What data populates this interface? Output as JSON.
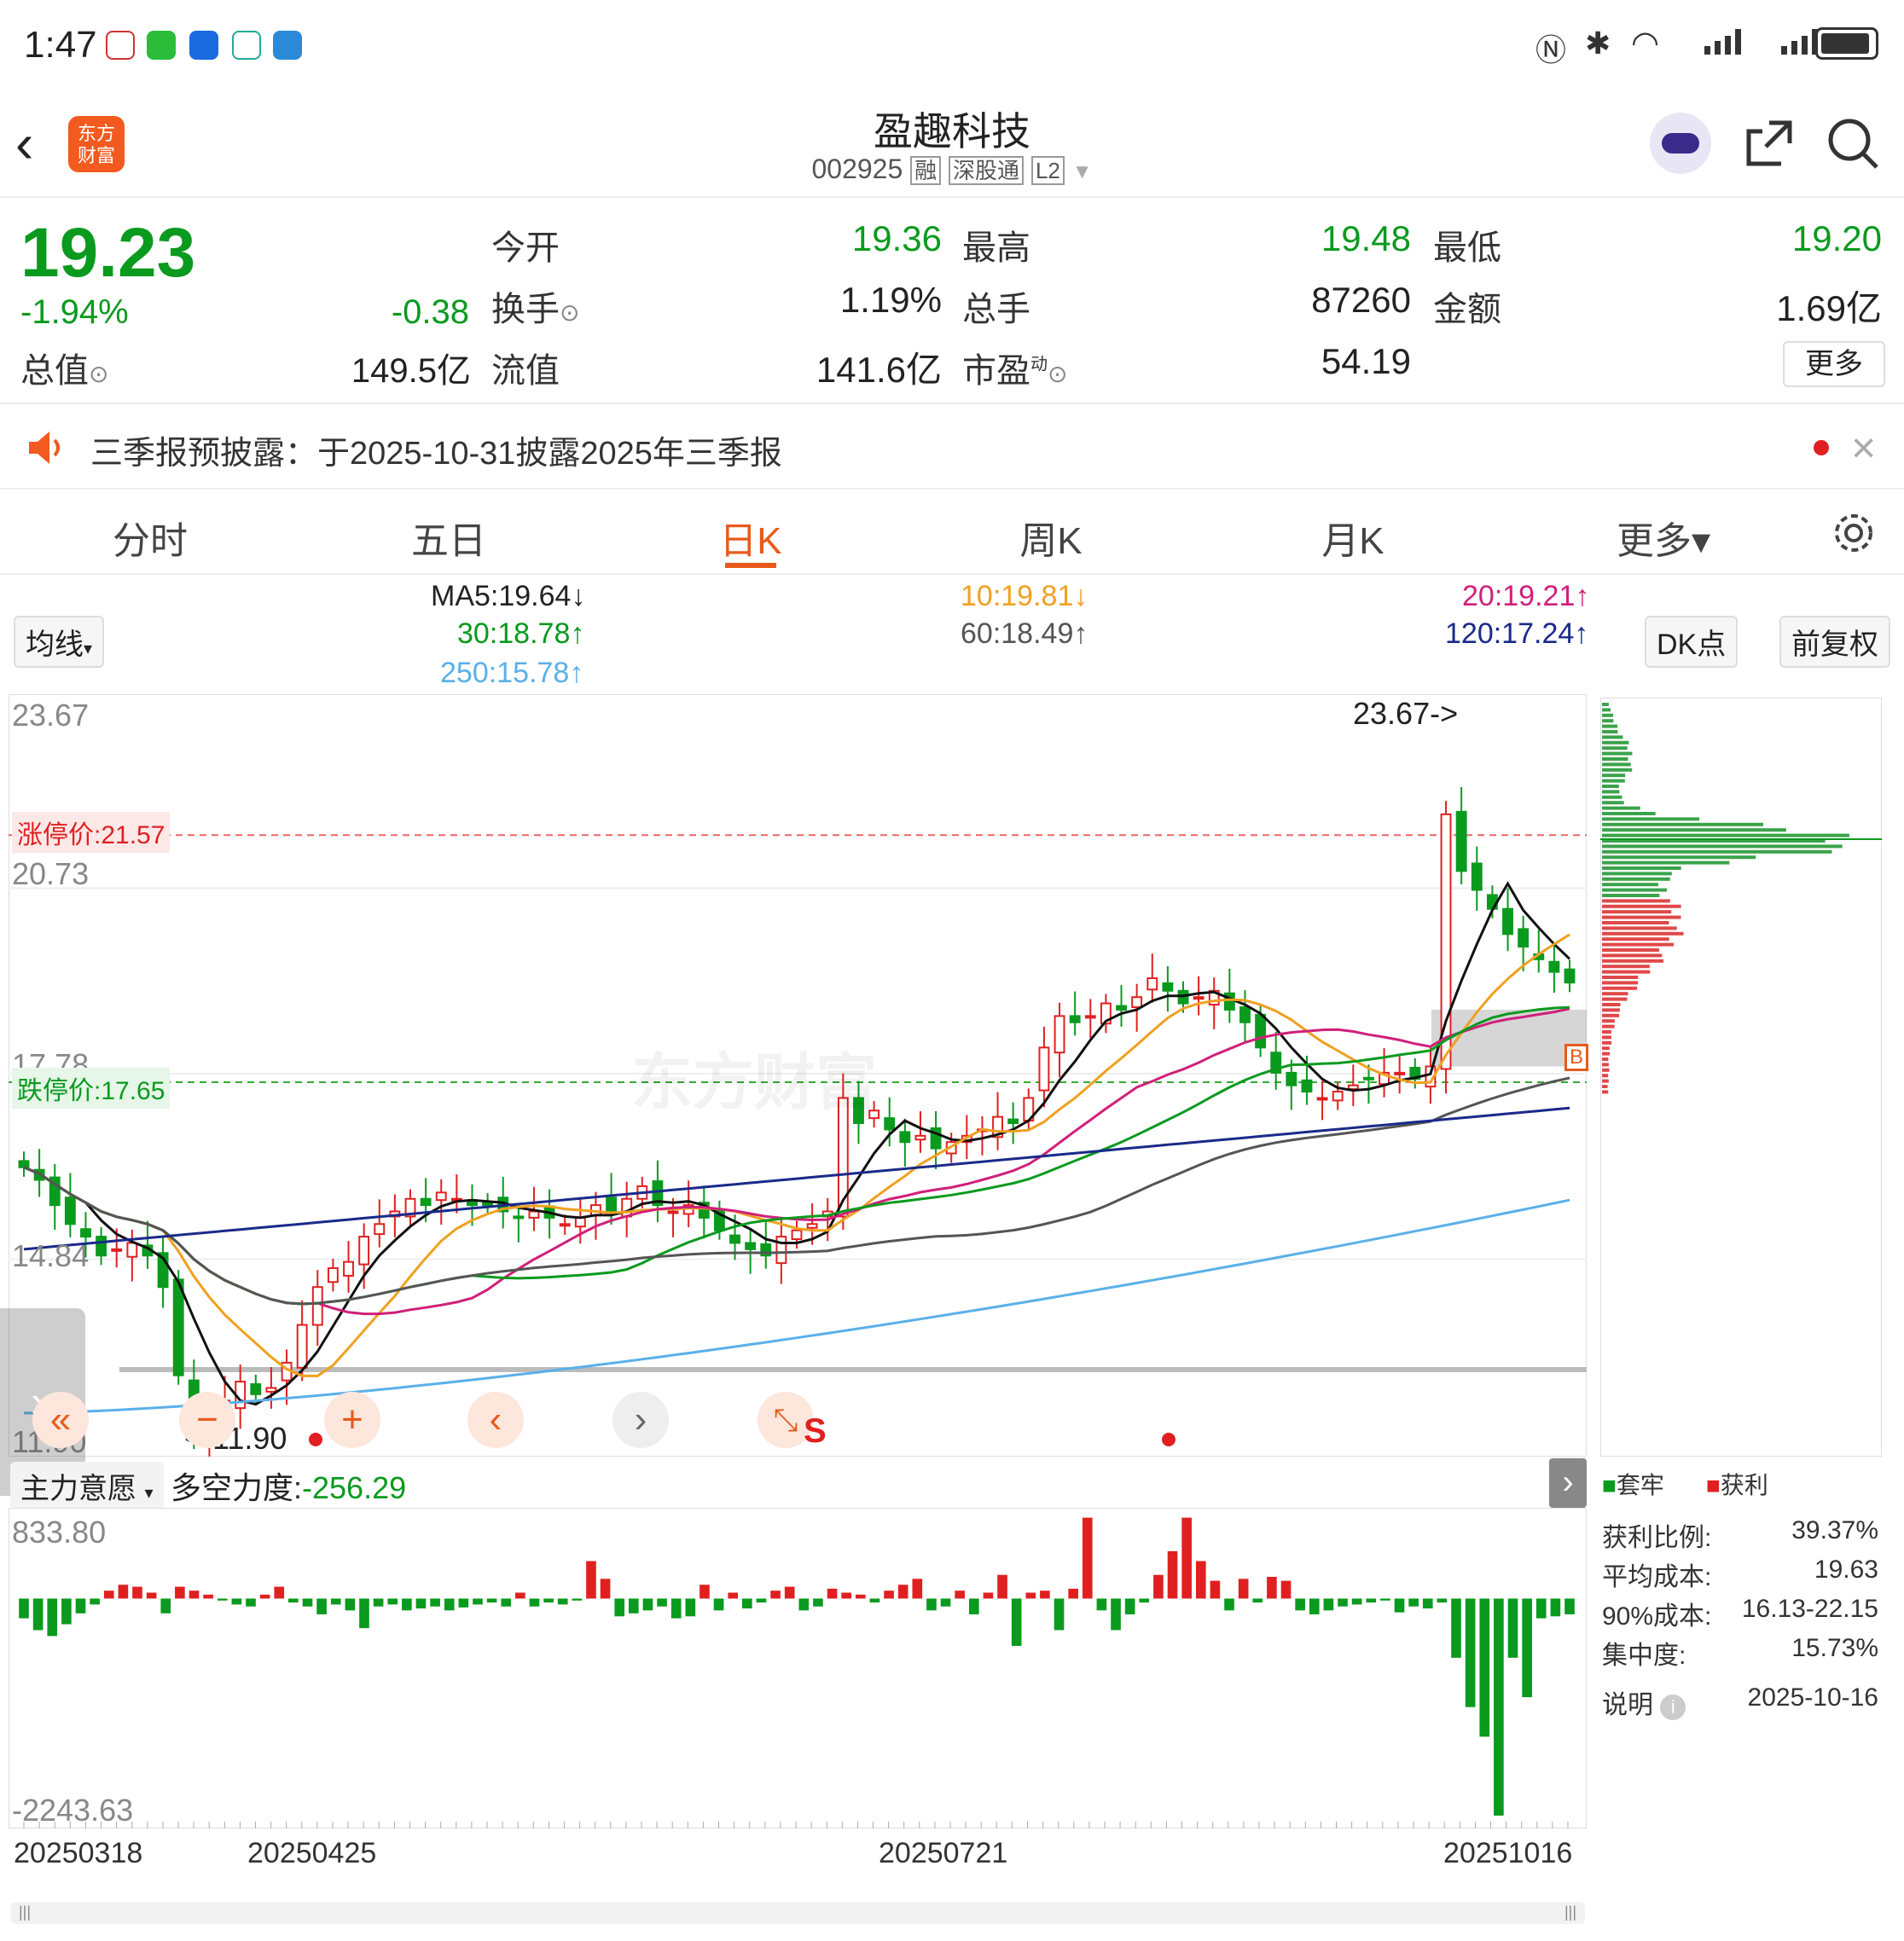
{
  "status": {
    "time": "1:47"
  },
  "header": {
    "title": "盈趣科技",
    "code": "002925",
    "tags": [
      "融",
      "深股通",
      "L2"
    ],
    "logo_text_1": "东方",
    "logo_text_2": "财富"
  },
  "quote": {
    "price": "19.23",
    "change_pct": "-1.94%",
    "change": "-0.38",
    "open_label": "今开",
    "open": "19.36",
    "high_label": "最高",
    "high": "19.48",
    "low_label": "最低",
    "low": "19.20",
    "turnover_label": "换手",
    "turnover": "1.19%",
    "volume_label": "总手",
    "volume": "87260",
    "amount_label": "金额",
    "amount": "1.69亿",
    "total_cap_label": "总值",
    "total_cap": "149.5亿",
    "float_cap_label": "流值",
    "float_cap": "141.6亿",
    "pe_label": "市盈",
    "pe_sup": "动",
    "pe": "54.19",
    "more_label": "更多"
  },
  "notice": {
    "text": "三季报预披露：于2025-10-31披露2025年三季报"
  },
  "tabs": [
    "分时",
    "五日",
    "日K",
    "周K",
    "月K",
    "更多▾"
  ],
  "ma": {
    "selector": "均线",
    "ma5": "MA5:19.64↓",
    "ma10": "10:19.81↓",
    "ma20": "20:19.21↑",
    "ma30": "30:18.78↑",
    "ma60": "60:18.49↑",
    "ma120": "120:17.24↑",
    "ma250": "250:15.78↑",
    "dk_label": "DK点",
    "adjust_label": "前复权",
    "colors": {
      "ma5": "#111111",
      "ma10": "#f0a020",
      "ma20": "#d0207a",
      "ma30": "#0a9a1e",
      "ma60": "#555555",
      "ma120": "#1a2a8a",
      "ma250": "#5ab0e8"
    }
  },
  "chart_data": {
    "type": "candlestick",
    "y_labels": [
      "23.67",
      "20.73",
      "17.78",
      "14.84",
      "11.90"
    ],
    "ylim": [
      11.9,
      23.67
    ],
    "limit_up": "涨停价:21.57",
    "limit_down": "跌停价:17.65",
    "max_marker": "23.67->",
    "min_marker": "<-11.90",
    "x_labels": [
      "20250318",
      "20250425",
      "20250721",
      "20251016"
    ],
    "watermark": "东方财富",
    "closes": [
      16.3,
      16.1,
      15.7,
      15.4,
      15.2,
      14.9,
      15.0,
      15.1,
      14.9,
      14.4,
      13.0,
      12.1,
      12.4,
      12.6,
      12.9,
      12.7,
      12.8,
      13.2,
      13.8,
      14.4,
      14.7,
      14.8,
      15.2,
      15.4,
      15.6,
      15.8,
      15.7,
      15.9,
      15.8,
      15.7,
      15.7,
      15.6,
      15.5,
      15.6,
      15.5,
      15.4,
      15.5,
      15.7,
      15.6,
      15.8,
      16.0,
      15.7,
      15.6,
      15.7,
      15.5,
      15.3,
      15.1,
      15.0,
      14.9,
      15.2,
      15.3,
      15.4,
      15.6,
      17.4,
      17.0,
      17.2,
      16.9,
      16.7,
      16.8,
      16.6,
      16.7,
      16.8,
      16.9,
      17.1,
      17.0,
      17.4,
      18.2,
      18.7,
      18.6,
      18.7,
      18.9,
      18.8,
      19.0,
      19.3,
      19.1,
      18.9,
      19.0,
      19.1,
      18.8,
      18.6,
      18.2,
      17.8,
      17.6,
      17.5,
      17.4,
      17.5,
      17.6,
      17.7,
      17.8,
      17.8,
      17.7,
      17.9,
      21.9,
      21.0,
      20.7,
      20.4,
      20.0,
      19.8,
      19.6,
      19.4,
      19.23
    ],
    "volume_indicator": {
      "name": "主力意愿",
      "label": "多空力度:",
      "value": "-256.29",
      "ymax": "833.80",
      "ymin": "-2243.63",
      "values": [
        -200,
        -320,
        -380,
        -260,
        -150,
        -60,
        80,
        140,
        120,
        60,
        -150,
        120,
        80,
        40,
        -20,
        -60,
        -80,
        40,
        120,
        -40,
        -80,
        -160,
        -60,
        -120,
        -300,
        -80,
        -60,
        -120,
        -100,
        -80,
        -120,
        -90,
        -60,
        -40,
        -80,
        60,
        -80,
        -40,
        -60,
        -20,
        380,
        200,
        -180,
        -150,
        -120,
        -80,
        -200,
        -180,
        140,
        -120,
        60,
        -100,
        -40,
        80,
        120,
        -120,
        -80,
        100,
        60,
        40,
        -40,
        80,
        140,
        200,
        -120,
        -80,
        80,
        -160,
        60,
        240,
        -480,
        60,
        80,
        -320,
        100,
        820,
        -120,
        -320,
        -160,
        -40,
        240,
        480,
        820,
        380,
        180,
        -120,
        200,
        -40,
        220,
        180,
        -120,
        -160,
        -120,
        -80,
        -60,
        -40,
        -20,
        -140,
        -80,
        -100,
        -40,
        -600,
        -1100,
        -1400,
        -2200,
        -600,
        -1000,
        -200,
        -180,
        -160
      ],
      "top_bar_values": [
        820,
        820
      ]
    },
    "chip_stats": {
      "legend_trapped": "套牢",
      "legend_profit": "获利",
      "profit_ratio_label": "获利比例:",
      "profit_ratio": "39.37%",
      "avg_cost_label": "平均成本:",
      "avg_cost": "19.63",
      "cost90_label": "90%成本:",
      "cost90": "16.13-22.15",
      "concentration_label": "集中度:",
      "concentration": "15.73%",
      "explain_label": "说明",
      "date": "2025-10-16"
    }
  },
  "chart_controls": {
    "s_label": "S"
  }
}
